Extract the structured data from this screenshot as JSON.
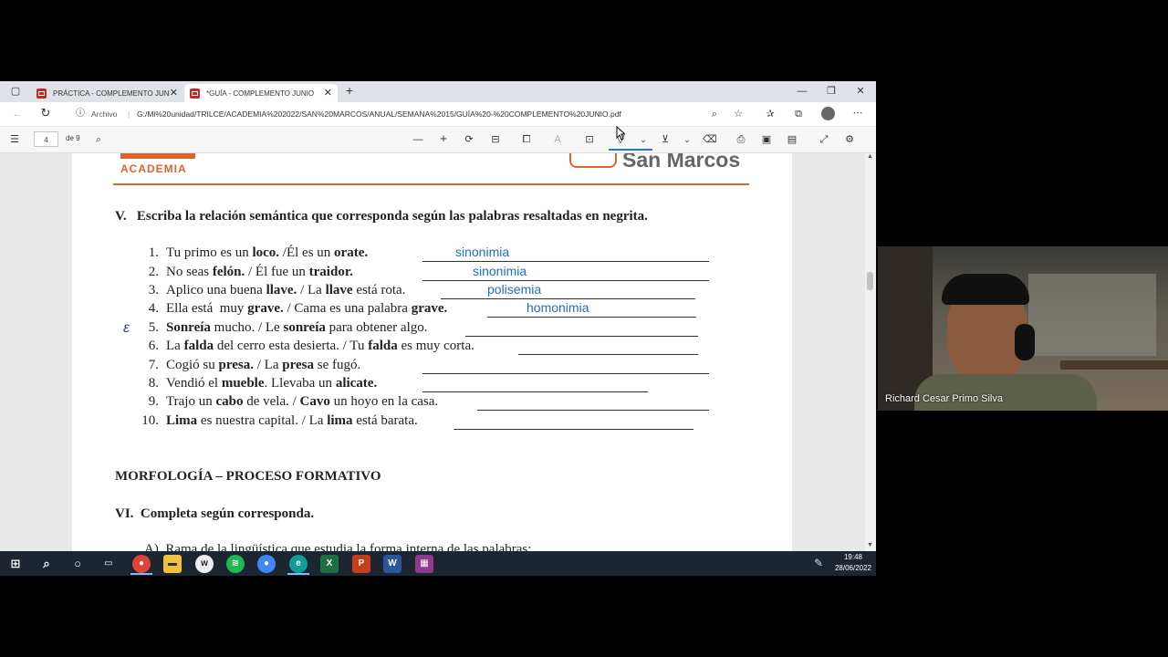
{
  "browser": {
    "tabs": [
      {
        "label": "PRÁCTICA - COMPLEMENTO JUN",
        "active": false
      },
      {
        "label": "*GUÍA - COMPLEMENTO JUNIO",
        "active": true
      }
    ],
    "new_tab_label": "+",
    "address": {
      "security_label": "Archivo",
      "url": "G:/Mi%20unidad/TRILCE/ACADEMIA%202022/SAN%20MARCOS/ANUAL/SEMANA%2015/GUÍA%20-%20COMPLEMENTO%20JUNIO.pdf"
    },
    "pdf_toolbar": {
      "page_current": "4",
      "page_total": "de 9"
    }
  },
  "document": {
    "logo_left": "ACADEMIA",
    "logo_right": "San Marcos",
    "section_v_title": "V.   Escriba la relación semántica que corresponda según las palabras resaltadas en negrita.",
    "items": [
      {
        "num": "1.",
        "html": "Tu primo es un <b>loco.</b> /Él es un <b>orate.</b>",
        "answer": "sinonimia"
      },
      {
        "num": "2.",
        "html": "No seas <b>felón.</b> / Él fue un <b>traidor.</b>",
        "answer": "sinonimia"
      },
      {
        "num": "3.",
        "html": "Aplico una buena <b>llave.</b> / La <b>llave</b> está rota.",
        "answer": "polisemia"
      },
      {
        "num": "4.",
        "html": "Ella está&nbsp; muy <b>grave.</b> / Cama es una palabra <b>grave.</b>",
        "answer": "homonimia"
      },
      {
        "num": "5.",
        "html": "<b>Sonreía</b> mucho. / Le <b>sonreía</b> para obtener algo.",
        "answer": ""
      },
      {
        "num": "6.",
        "html": "La <b>falda</b> del cerro esta desierta. / Tu <b>falda</b> es muy corta.",
        "answer": ""
      },
      {
        "num": "7.",
        "html": "Cogió su <b>presa.</b> / La <b>presa</b> se fugó.",
        "answer": ""
      },
      {
        "num": "8.",
        "html": "Vendió el <b>mueble</b>. Llevaba un <b>alicate.</b>",
        "answer": ""
      },
      {
        "num": "9.",
        "html": "Trajo un <b>cabo</b> de vela. / <b>Cavo</b> un hoyo en la casa.",
        "answer": ""
      },
      {
        "num": "10.",
        "html": "<b>Lima</b> es nuestra capital. / La <b>lima</b> está barata.",
        "answer": ""
      }
    ],
    "handwritten_mark": "ε",
    "morfologia_title": "MORFOLOGÍA – PROCESO FORMATIVO",
    "section_vi_title": "VI.  Completa según corresponda.",
    "cut_line": "A)  Rama de la lingüística que estudia la forma interna de las palabras:"
  },
  "taskbar": {
    "time": "19:48",
    "date": "28/06/2022",
    "apps": [
      "start-icon",
      "search-icon",
      "cortana-icon",
      "task-view-icon",
      "chrome-icon",
      "file-explorer-icon",
      "whatsapp-icon",
      "spotify-icon",
      "chrome-icon",
      "edge-icon",
      "excel-icon",
      "powerpoint-icon",
      "word-icon",
      "winrar-icon"
    ]
  },
  "video": {
    "participant_name": "Richard Cesar Primo Silva"
  },
  "colors": {
    "accent_orange": "#e0642a",
    "answer_blue": "#1f6fbf",
    "taskbar": "#1c2530"
  }
}
